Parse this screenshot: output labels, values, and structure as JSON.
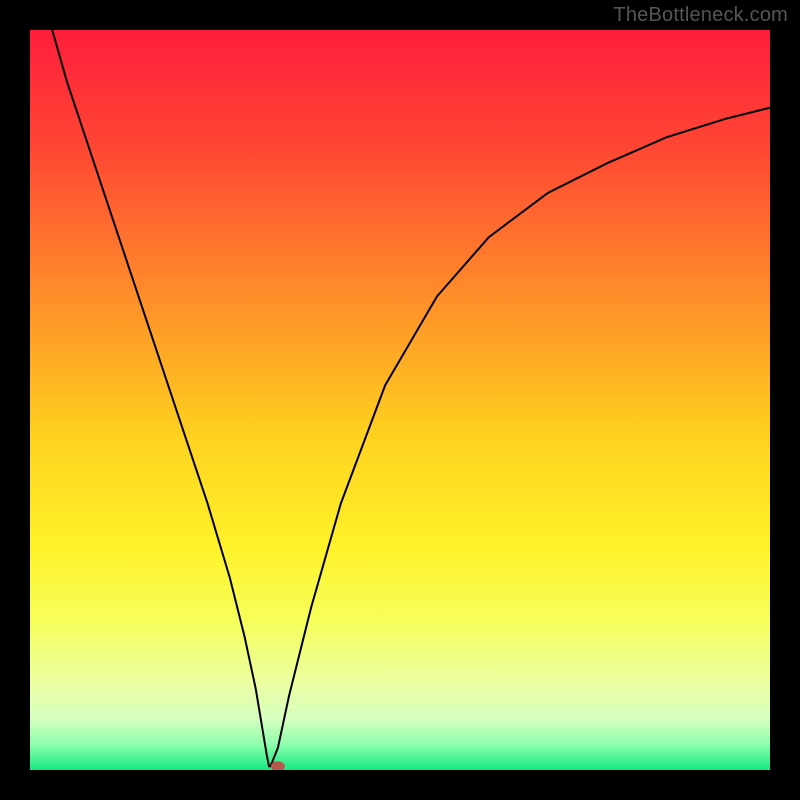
{
  "watermark": "TheBottleneck.com",
  "chart_data": {
    "type": "line",
    "title": "",
    "xlabel": "",
    "ylabel": "",
    "xlim": [
      0,
      100
    ],
    "ylim": [
      0,
      100
    ],
    "grid": false,
    "series": [
      {
        "name": "curve",
        "x": [
          3,
          5,
          8,
          12,
          16,
          20,
          24,
          27,
          29,
          30.5,
          31.5,
          32,
          32.3,
          32.5,
          33.5,
          35,
          38,
          42,
          48,
          55,
          62,
          70,
          78,
          86,
          94,
          100
        ],
        "y": [
          100,
          93,
          84,
          72,
          60,
          48,
          36,
          26,
          18,
          11,
          5,
          2,
          0.5,
          0.5,
          3,
          10,
          22,
          36,
          52,
          64,
          72,
          78,
          82,
          85.5,
          88,
          89.5
        ]
      }
    ],
    "marker": {
      "x": 33.5,
      "y": 0.5
    },
    "gradient_stops": [
      {
        "pos": 0.0,
        "color": "#ff1e3c"
      },
      {
        "pos": 0.15,
        "color": "#ff4334"
      },
      {
        "pos": 0.35,
        "color": "#ff8a2a"
      },
      {
        "pos": 0.55,
        "color": "#ffd21f"
      },
      {
        "pos": 0.7,
        "color": "#fff22a"
      },
      {
        "pos": 0.8,
        "color": "#f6ff5c"
      },
      {
        "pos": 0.88,
        "color": "#ecffa0"
      },
      {
        "pos": 0.93,
        "color": "#d7ffc0"
      },
      {
        "pos": 0.965,
        "color": "#8effad"
      },
      {
        "pos": 1.0,
        "color": "#17e884"
      }
    ]
  }
}
